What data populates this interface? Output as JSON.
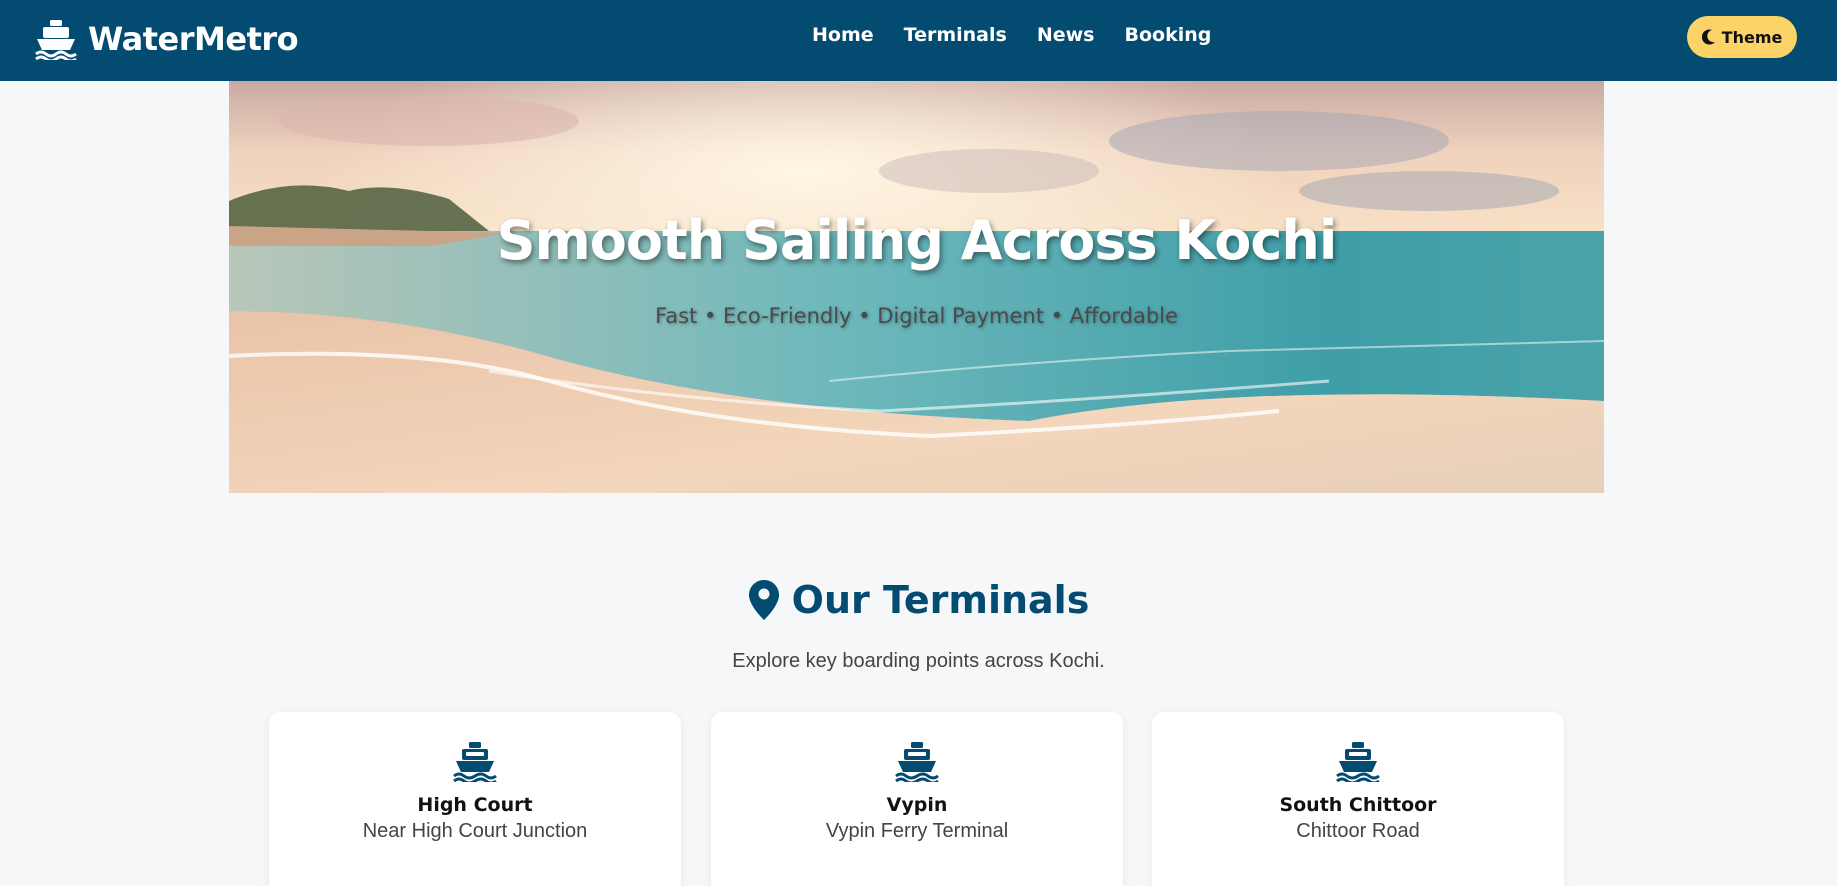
{
  "navbar": {
    "brand": "WaterMetro",
    "brand_icon": "ship-icon",
    "links": [
      "Home",
      "Terminals",
      "News",
      "Booking"
    ],
    "theme_button": "Theme",
    "theme_icon": "moon-icon"
  },
  "hero": {
    "title": "Smooth Sailing Across Kochi",
    "subtitle": "Fast • Eco-Friendly • Digital Payment • Affordable"
  },
  "terminals": {
    "icon": "map-pin-icon",
    "title": "Our Terminals",
    "subtitle": "Explore key boarding points across Kochi.",
    "items": [
      {
        "name": "High Court",
        "location": "Near High Court Junction",
        "icon": "ship-icon"
      },
      {
        "name": "Vypin",
        "location": "Vypin Ferry Terminal",
        "icon": "ship-icon"
      },
      {
        "name": "South Chittoor",
        "location": "Chittoor Road",
        "icon": "ship-icon"
      }
    ]
  },
  "colors": {
    "navbar_bg": "#044b72",
    "theme_button_bg": "#fcd367",
    "page_bg": "#f5f7f9",
    "accent": "#044b72"
  }
}
